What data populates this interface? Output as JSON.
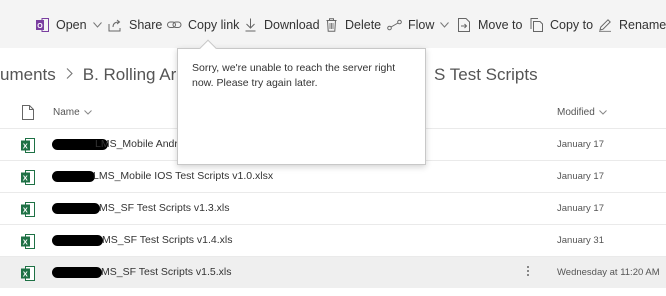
{
  "commands": [
    {
      "label": "Open",
      "icon": "open-icon",
      "dropdown": true
    },
    {
      "label": "Share",
      "icon": "share-icon"
    },
    {
      "label": "Copy link",
      "icon": "link-icon"
    },
    {
      "label": "Download",
      "icon": "download-icon"
    },
    {
      "label": "Delete",
      "icon": "delete-icon"
    },
    {
      "label": "Flow",
      "icon": "flow-icon",
      "dropdown": true
    },
    {
      "label": "Move to",
      "icon": "move-to-icon"
    },
    {
      "label": "Copy to",
      "icon": "copy-to-icon"
    },
    {
      "label": "Rename",
      "icon": "rename-icon"
    }
  ],
  "breadcrumb": {
    "first": "uments",
    "second": "B. Rolling Arra",
    "tail": "S Test Scripts"
  },
  "columns": {
    "name": "Name",
    "modified": "Modified"
  },
  "files": [
    {
      "name": "LMS_Mobile Andr",
      "modified": "January 17",
      "selected": false
    },
    {
      "name": "LMS_Mobile IOS Test Scripts v1.0.xlsx",
      "modified": "January 17",
      "selected": false
    },
    {
      "name": "MS_SF Test Scripts v1.3.xls",
      "modified": "January 17",
      "selected": false
    },
    {
      "name": "MS_SF Test Scripts v1.4.xls",
      "modified": "January 31",
      "selected": false
    },
    {
      "name": "MS_SF Test Scripts v1.5.xls",
      "modified": "Wednesday at 11:20 AM",
      "selected": true
    }
  ],
  "popup": {
    "message": "Sorry, we're unable to reach the server right now. Please try again later."
  },
  "colors": {
    "excel_green": "#1e7145",
    "command_bar_bg": "#f4f4f4",
    "office_purple": "#7a3ea0"
  }
}
